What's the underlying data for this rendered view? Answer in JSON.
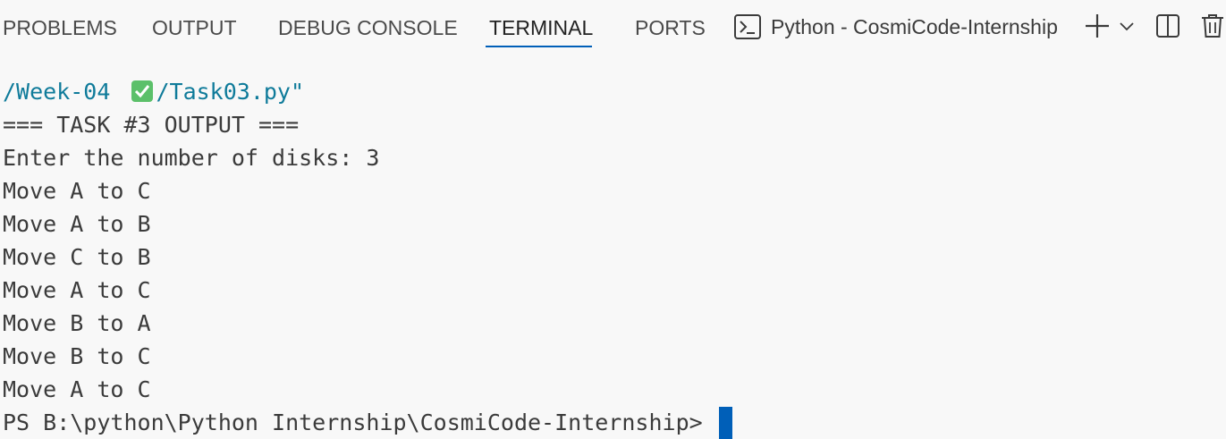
{
  "panel": {
    "tabs": [
      {
        "label": "PROBLEMS",
        "active": false
      },
      {
        "label": "OUTPUT",
        "active": false
      },
      {
        "label": "DEBUG CONSOLE",
        "active": false
      },
      {
        "label": "TERMINAL",
        "active": true
      },
      {
        "label": "PORTS",
        "active": false
      }
    ],
    "terminal_selector": {
      "icon": "terminal-icon",
      "label": "Python - CosmiCode-Internship"
    },
    "actions": {
      "new_terminal_icon": "plus-icon",
      "launch_profile_icon": "chevron-down-icon",
      "split_icon": "split-terminal-icon",
      "kill_icon": "trash-icon"
    },
    "accent_color": "#005fb8"
  },
  "terminal": {
    "path_part1": "/Week-04 ",
    "path_check_icon": "check-box-emoji",
    "path_part2": "/Task03.py\"",
    "output_lines": [
      "=== TASK #3 OUTPUT ===",
      "Enter the number of disks: 3",
      "Move A to C",
      "Move A to B",
      "Move C to B",
      "Move A to C",
      "Move B to A",
      "Move B to C",
      "Move A to C"
    ],
    "prompt": "PS B:\\python\\Python Internship\\CosmiCode-Internship>"
  }
}
